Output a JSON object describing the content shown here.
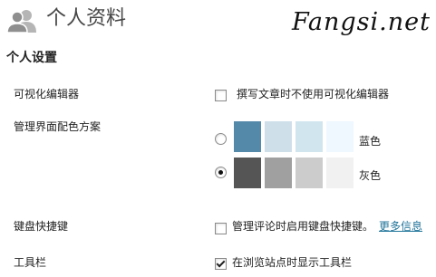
{
  "header": {
    "title": "个人资料",
    "watermark": "Fangsi.net"
  },
  "section": {
    "title": "个人设置"
  },
  "rows": {
    "visual_editor": {
      "label": "可视化编辑器",
      "option_text": "撰写文章时不使用可视化编辑器",
      "checked": false
    },
    "color_scheme": {
      "label": "管理界面配色方案",
      "schemes": [
        {
          "name": "蓝色",
          "selected": false,
          "colors": [
            "#5589aa",
            "#cfdfe9",
            "#d1e5ee",
            "#eff8ff"
          ]
        },
        {
          "name": "灰色",
          "selected": true,
          "colors": [
            "#555555",
            "#a0a0a0",
            "#cccccc",
            "#f1f1f1"
          ]
        }
      ]
    },
    "keyboard_shortcuts": {
      "label": "键盘快捷键",
      "option_text": "管理评论时启用键盘快捷键。",
      "link_text": "更多信息",
      "checked": false
    },
    "toolbar": {
      "label": "工具栏",
      "option_text": "在浏览站点时显示工具栏",
      "checked": true
    }
  }
}
